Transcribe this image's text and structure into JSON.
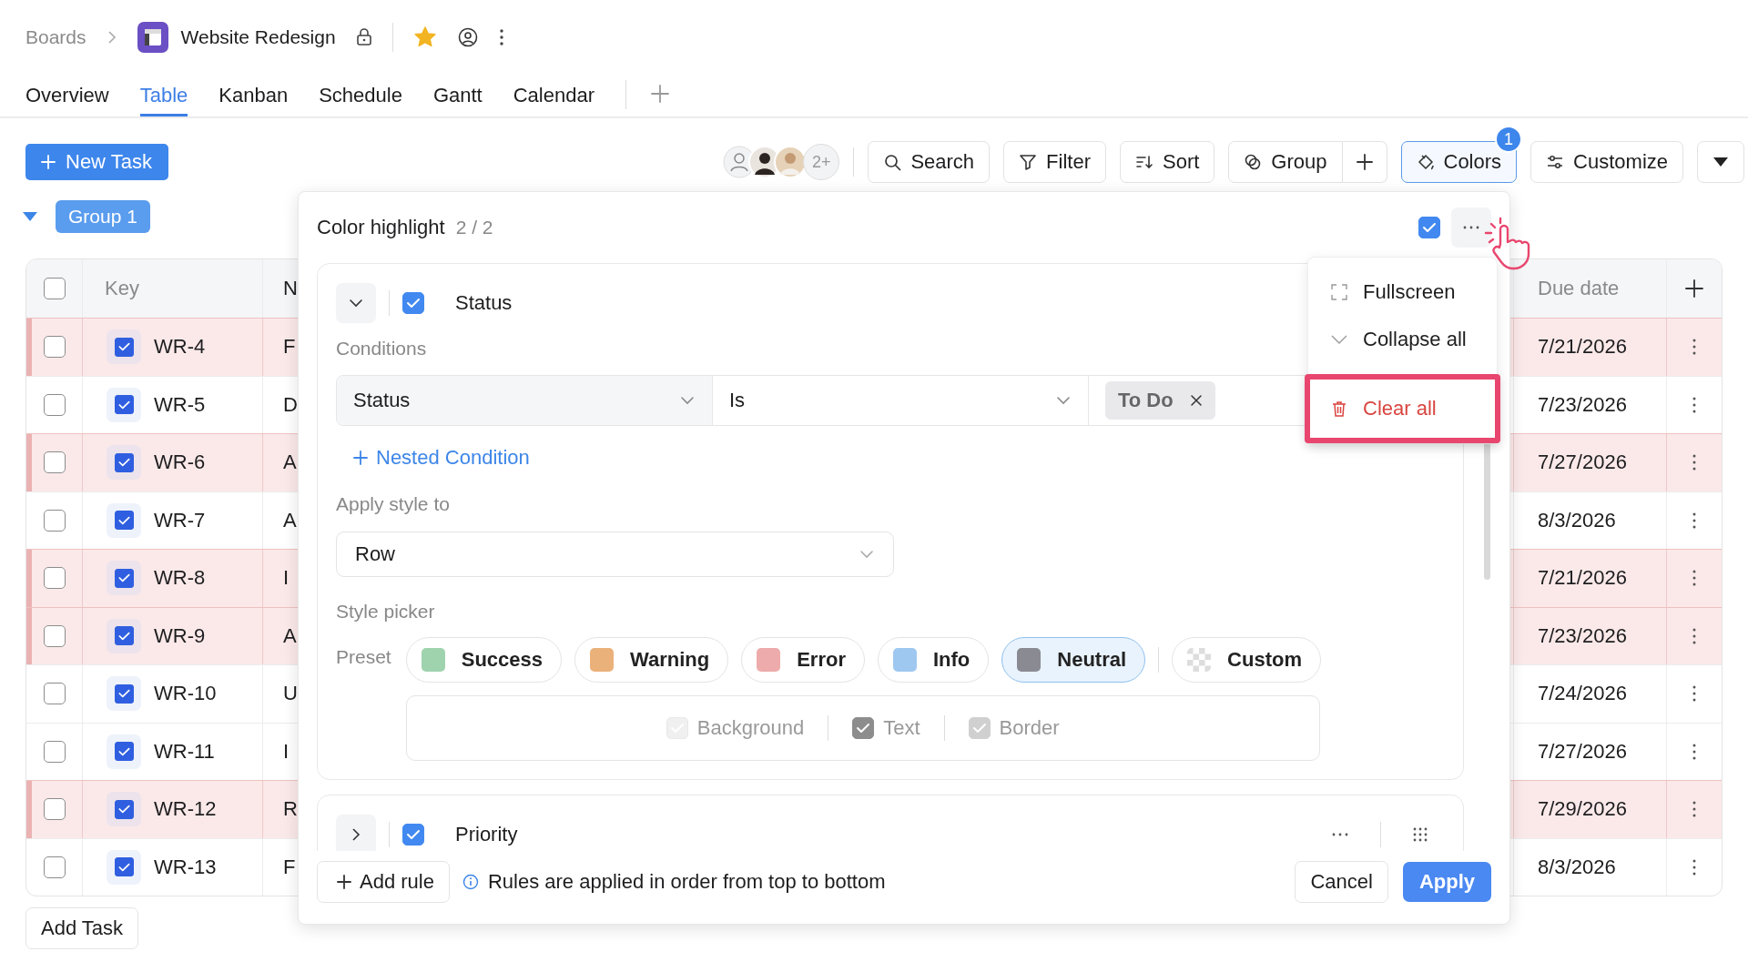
{
  "breadcrumb": {
    "parent": "Boards",
    "title": "Website Redesign",
    "starred": true
  },
  "tabs": [
    {
      "label": "Overview",
      "selected": false
    },
    {
      "label": "Table",
      "selected": true
    },
    {
      "label": "Kanban",
      "selected": false
    },
    {
      "label": "Schedule",
      "selected": false
    },
    {
      "label": "Gantt",
      "selected": false
    },
    {
      "label": "Calendar",
      "selected": false
    }
  ],
  "toolbar": {
    "new_task": "New Task",
    "avatars_more": "2+",
    "buttons": [
      {
        "kind": "search",
        "label": "Search",
        "selected": false
      },
      {
        "kind": "filter",
        "label": "Filter",
        "selected": false
      },
      {
        "kind": "sort",
        "label": "Sort",
        "selected": false
      },
      {
        "kind": "group",
        "label": "Group",
        "selected": false
      },
      {
        "kind": "add",
        "selected": false
      },
      {
        "kind": "colors",
        "label": "Colors",
        "selected": true,
        "badge": "1"
      },
      {
        "kind": "customize",
        "label": "Customize",
        "selected": false
      },
      {
        "kind": "dropdown",
        "selected": false
      }
    ]
  },
  "group": {
    "label": "Group 1",
    "expanded": true
  },
  "table": {
    "all_selected": false,
    "columns": [
      "Key",
      "N",
      "Due date"
    ],
    "rows": [
      {
        "selected": false,
        "checked": true,
        "key": "WR-4",
        "name": "F",
        "due": "7/21/2026",
        "highlighted": true
      },
      {
        "selected": false,
        "checked": true,
        "key": "WR-5",
        "name": "D",
        "due": "7/23/2026",
        "highlighted": false
      },
      {
        "selected": false,
        "checked": true,
        "key": "WR-6",
        "name": "A",
        "due": "7/27/2026",
        "highlighted": true
      },
      {
        "selected": false,
        "checked": true,
        "key": "WR-7",
        "name": "A",
        "due": "8/3/2026",
        "highlighted": false
      },
      {
        "selected": false,
        "checked": true,
        "key": "WR-8",
        "name": "I",
        "due": "7/21/2026",
        "highlighted": true
      },
      {
        "selected": false,
        "checked": true,
        "key": "WR-9",
        "name": "A",
        "due": "7/23/2026",
        "highlighted": true
      },
      {
        "selected": false,
        "checked": true,
        "key": "WR-10",
        "name": "U",
        "due": "7/24/2026",
        "highlighted": false
      },
      {
        "selected": false,
        "checked": true,
        "key": "WR-11",
        "name": "I",
        "due": "7/27/2026",
        "highlighted": false
      },
      {
        "selected": false,
        "checked": true,
        "key": "WR-12",
        "name": "R",
        "due": "7/29/2026",
        "highlighted": true
      },
      {
        "selected": false,
        "checked": true,
        "key": "WR-13",
        "name": "F",
        "due": "8/3/2026",
        "highlighted": false
      }
    ],
    "add_task": "Add Task"
  },
  "color_highlight": {
    "title": "Color highlight",
    "count": "2 / 2",
    "enabled": true,
    "rules": [
      {
        "field": "Status",
        "enabled": true,
        "expanded": true,
        "conditions_label": "Conditions",
        "condition": {
          "field": "Status",
          "operator": "Is",
          "values": [
            "To Do"
          ]
        },
        "nested_label": "Nested Condition",
        "apply_label": "Apply style to",
        "apply_value": "Row",
        "style_label": "Style picker",
        "preset_label": "Preset",
        "presets": [
          {
            "kind": "swatch",
            "label": "Success",
            "color": "#9fd3ae",
            "selected": false
          },
          {
            "kind": "swatch",
            "label": "Warning",
            "color": "#ebb17a",
            "selected": false
          },
          {
            "kind": "swatch",
            "label": "Error",
            "color": "#eeabab",
            "selected": false
          },
          {
            "kind": "swatch",
            "label": "Info",
            "color": "#9fc8f0",
            "selected": false
          },
          {
            "kind": "swatch",
            "label": "Neutral",
            "color": "#8a8a93",
            "selected": true
          },
          {
            "kind": "custom",
            "label": "Custom",
            "selected": false
          }
        ],
        "targets": [
          {
            "label": "Background",
            "checked": true,
            "disabled": true
          },
          {
            "label": "Text",
            "checked": true,
            "disabled": false
          },
          {
            "label": "Border",
            "checked": true,
            "disabled": true
          }
        ]
      },
      {
        "field": "Priority",
        "enabled": true,
        "expanded": false
      }
    ],
    "add_rule": "Add rule",
    "info": "Rules are applied in order from top to bottom",
    "cancel": "Cancel",
    "apply": "Apply"
  },
  "menu": {
    "items": [
      {
        "kind": "fullscreen",
        "label": "Fullscreen",
        "danger": false,
        "highlighted": false
      },
      {
        "kind": "collapse",
        "label": "Collapse all",
        "danger": false,
        "highlighted": false
      },
      {
        "kind": "clear",
        "label": "Clear all",
        "danger": true,
        "highlighted": true
      }
    ]
  }
}
